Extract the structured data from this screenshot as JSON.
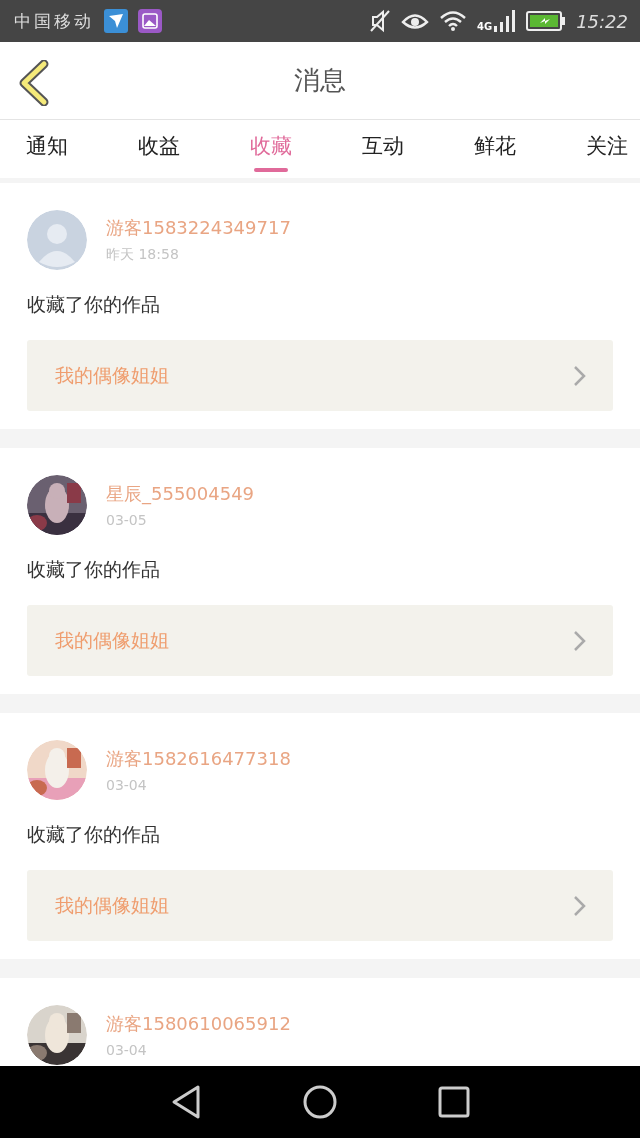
{
  "status_bar": {
    "carrier": "中国移动",
    "network": "4G",
    "time": "15:22"
  },
  "header": {
    "title": "消息"
  },
  "tabs": [
    {
      "label": "通知",
      "selected": false
    },
    {
      "label": "收益",
      "selected": false
    },
    {
      "label": "收藏",
      "selected": true
    },
    {
      "label": "互动",
      "selected": false
    },
    {
      "label": "鲜花",
      "selected": false
    },
    {
      "label": "关注",
      "selected": false
    }
  ],
  "messages": [
    {
      "avatar": {
        "kind": "default"
      },
      "user": "游客1583224349717",
      "time": "昨天 18:58",
      "text": "收藏了你的作品",
      "work": "我的偶像姐姐"
    },
    {
      "user": "星辰_555004549",
      "time": "03-05",
      "text": "收藏了你的作品",
      "work": "我的偶像姐姐"
    },
    {
      "user": "游客1582616477318",
      "time": "03-04",
      "text": "收藏了你的作品",
      "work": "我的偶像姐姐"
    },
    {
      "user": "游客1580610065912",
      "time": "03-04"
    }
  ]
}
